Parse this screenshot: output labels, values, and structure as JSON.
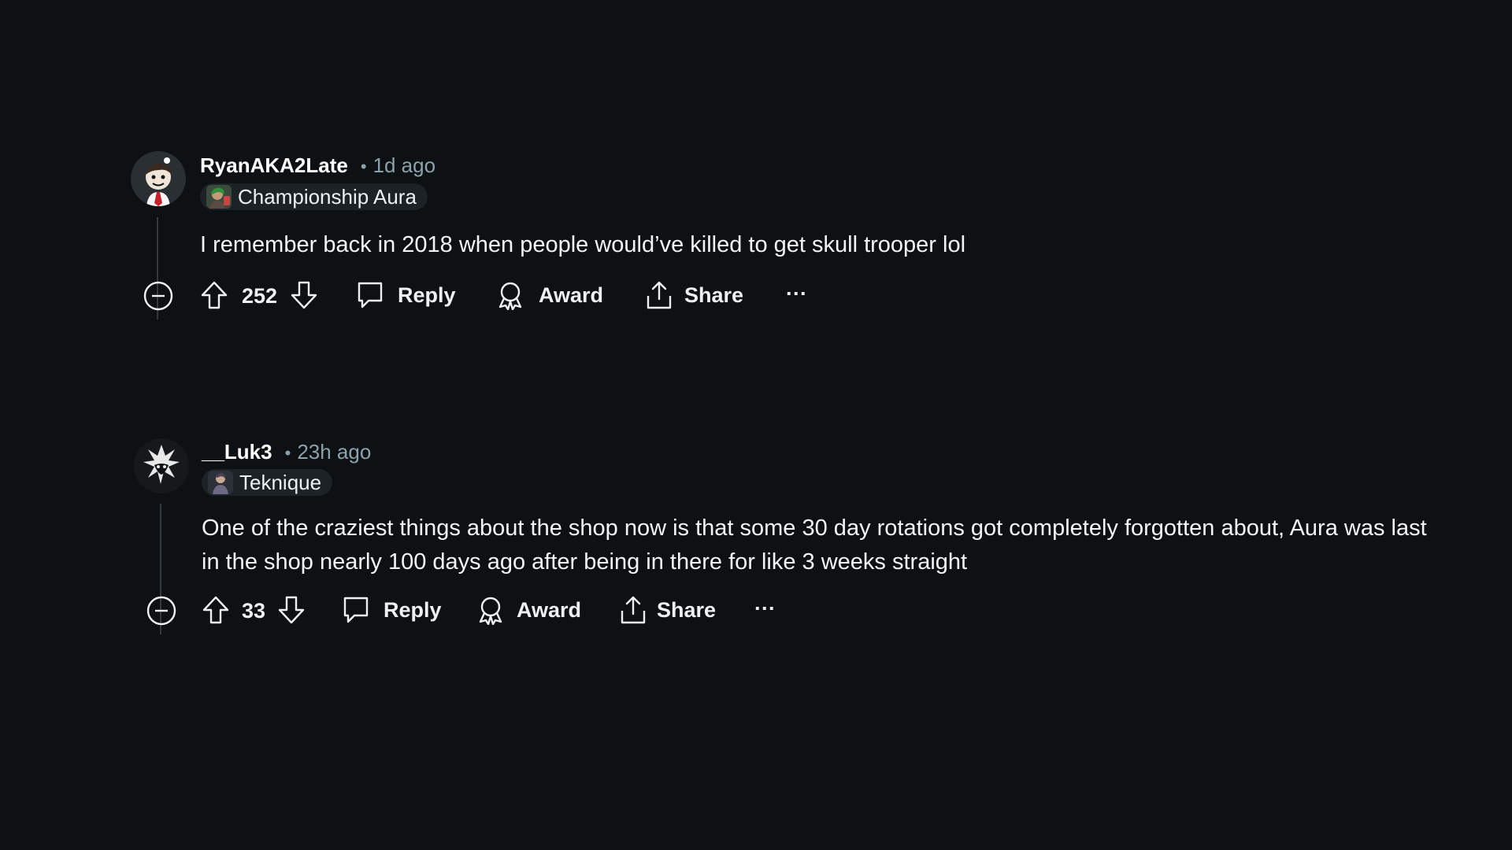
{
  "comments": [
    {
      "username": "RyanAKA2Late",
      "separator": "•",
      "time": "1d ago",
      "flair": "Championship Aura",
      "body": "I remember back in 2018 when people would’ve killed to get skull trooper lol",
      "votes": "252",
      "actions": {
        "reply": "Reply",
        "award": "Award",
        "share": "Share",
        "more": "···"
      }
    },
    {
      "username": "__Luk3",
      "separator": "•",
      "time": "23h ago",
      "flair": "Teknique",
      "body": "One of the craziest things about the shop now is that some 30 day rotations got completely forgotten about, Aura was last in the shop nearly 100 days ago after being in there for like 3 weeks straight",
      "votes": "33",
      "actions": {
        "reply": "Reply",
        "award": "Award",
        "share": "Share",
        "more": "···"
      }
    }
  ],
  "icons": {
    "collapse": "minus-circle-icon",
    "upvote": "arrow-up-icon",
    "downvote": "arrow-down-icon",
    "reply": "speech-bubble-icon",
    "award": "award-ribbon-icon",
    "share": "share-upload-icon",
    "more": "more-dots-icon"
  },
  "colors": {
    "background": "#0e1113",
    "text": "#f2f4f5",
    "meta": "#8ba2ad",
    "flair_bg": "#1d2226",
    "thread_line": "#33383c"
  }
}
